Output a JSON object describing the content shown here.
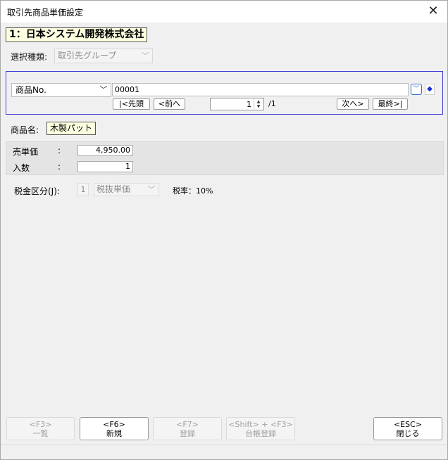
{
  "window": {
    "title": "取引先商品単価設定",
    "close_glyph": "✕"
  },
  "partner": {
    "label": "1：日本システム開発株式会社"
  },
  "selection": {
    "label": "選択種類:",
    "value": "取引先グループ"
  },
  "product": {
    "key_field": "商品No.",
    "code": "00001",
    "nav": {
      "first": "|<先頭",
      "prev": "<前へ",
      "next": "次へ>",
      "last": "最終>|"
    },
    "page_current": "1",
    "page_total": "/1"
  },
  "product_name": {
    "label": "商品名:",
    "value": "木製パット"
  },
  "prices": {
    "unit_price": {
      "label": "売単価",
      "colon": ":",
      "value": "4,950.00"
    },
    "quantity": {
      "label": "入数",
      "colon": ":",
      "value": "1"
    }
  },
  "tax": {
    "label": "税金区分(J):",
    "code": "1",
    "type": "税抜単価",
    "rate": "税率：10%"
  },
  "function_keys": [
    {
      "key": "<F3>",
      "label": "一覧",
      "enabled": false
    },
    {
      "key": "<F6>",
      "label": "新規",
      "enabled": true
    },
    {
      "key": "<F7>",
      "label": "登録",
      "enabled": false
    },
    {
      "key": "<Shift> + <F3>",
      "label": "台帳登録",
      "enabled": false
    },
    {
      "key": "<ESC>",
      "label": "閉じる",
      "enabled": true
    }
  ]
}
